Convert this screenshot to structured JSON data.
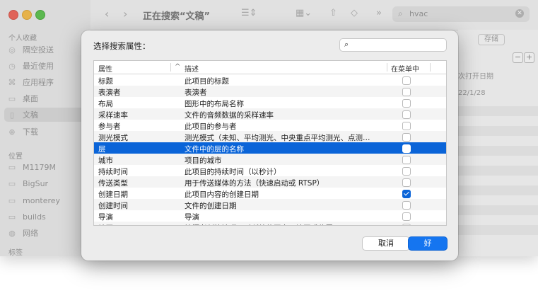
{
  "finder": {
    "toolbar_title": "正在搜索“文稿”",
    "search_query": "hvac",
    "save_label": "存储",
    "minus_label": "−",
    "plus_label": "+",
    "col_last_opened_fragment": "次打开日期",
    "date_fragment": "22/1/28",
    "sidebar": {
      "favorites_header": "个人收藏",
      "favorites": [
        {
          "label": "隔空投送",
          "icon": "airdrop-icon"
        },
        {
          "label": "最近使用",
          "icon": "clock-icon"
        },
        {
          "label": "应用程序",
          "icon": "apps-icon"
        },
        {
          "label": "桌面",
          "icon": "desktop-icon"
        },
        {
          "label": "文稿",
          "icon": "document-icon",
          "active": true
        },
        {
          "label": "下载",
          "icon": "download-icon"
        }
      ],
      "locations_header": "位置",
      "locations": [
        {
          "label": "M1179M",
          "icon": "disk-icon"
        },
        {
          "label": "BigSur",
          "icon": "disk-icon"
        },
        {
          "label": "monterey",
          "icon": "disk-icon"
        },
        {
          "label": "builds",
          "icon": "disk-icon"
        },
        {
          "label": "网络",
          "icon": "globe-icon"
        }
      ],
      "tags_header": "标签"
    }
  },
  "dialog": {
    "title": "选择搜索属性：",
    "search_placeholder": "",
    "columns": {
      "attribute": "属性",
      "description": "描述",
      "in_menu": "在菜单中"
    },
    "rows": [
      {
        "attribute": "标题",
        "description": "此项目的标题",
        "in_menu": false
      },
      {
        "attribute": "表演者",
        "description": "表演者",
        "in_menu": false
      },
      {
        "attribute": "布局",
        "description": "图形中的布局名称",
        "in_menu": false
      },
      {
        "attribute": "采样速率",
        "description": "文件的音频数据的采样速率",
        "in_menu": false
      },
      {
        "attribute": "参与者",
        "description": "此项目的参与者",
        "in_menu": false
      },
      {
        "attribute": "测光模式",
        "description": "测光模式（未知、平均测光、中央重点平均测光、点测…",
        "in_menu": false
      },
      {
        "attribute": "层",
        "description": "文件中的层的名称",
        "in_menu": false,
        "selected": true
      },
      {
        "attribute": "城市",
        "description": "项目的城市",
        "in_menu": false
      },
      {
        "attribute": "持续时间",
        "description": "此项目的持续时间（以秒计）",
        "in_menu": false
      },
      {
        "attribute": "传送类型",
        "description": "用于传送媒体的方法（快速启动或 RTSP）",
        "in_menu": false
      },
      {
        "attribute": "创建日期",
        "description": "此项目内容的创建日期",
        "in_menu": true
      },
      {
        "attribute": "创建时间",
        "description": "文件的创建日期",
        "in_menu": false
      },
      {
        "attribute": "导演",
        "description": "导演",
        "in_menu": false
      },
      {
        "attribute": "地区",
        "description": "拍摄者创建该项目时所处的国家、地区或位置",
        "in_menu": false
      }
    ],
    "cancel_label": "取消",
    "ok_label": "好"
  }
}
